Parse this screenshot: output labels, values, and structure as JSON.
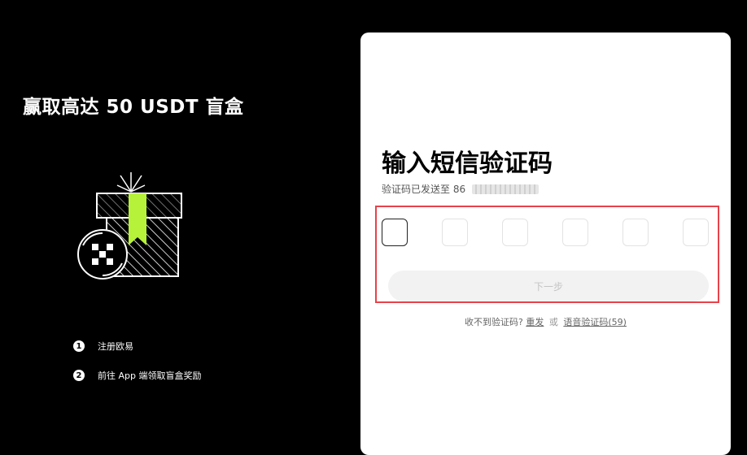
{
  "promo": {
    "title": "赢取高达 50 USDT 盲盒",
    "steps": [
      {
        "num": "1",
        "text": "注册欧易"
      },
      {
        "num": "2",
        "text": "前往 App 端领取盲盒奖励"
      }
    ]
  },
  "verify": {
    "heading": "输入短信验证码",
    "sent_text": "验证码已发送至 86",
    "code_digits": [
      "",
      "",
      "",
      "",
      "",
      ""
    ],
    "next_label": "下一步",
    "not_received": "收不到验证码?",
    "resend": "重发",
    "or": "或",
    "voice_code": "语音验证码(59)"
  },
  "colors": {
    "accent_green": "#b6f23a",
    "highlight_red": "#e8424a"
  }
}
